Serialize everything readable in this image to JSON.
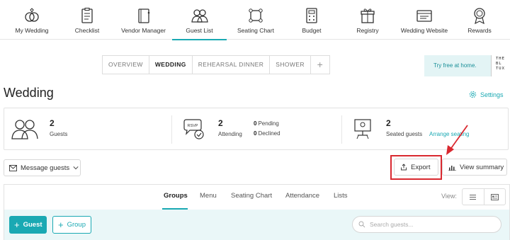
{
  "nav": {
    "items": [
      {
        "label": "My Wedding",
        "icon": "rings-icon"
      },
      {
        "label": "Checklist",
        "icon": "checklist-icon"
      },
      {
        "label": "Vendor Manager",
        "icon": "vendor-book-icon"
      },
      {
        "label": "Guest List",
        "icon": "guests-icon"
      },
      {
        "label": "Seating Chart",
        "icon": "seating-chart-icon"
      },
      {
        "label": "Budget",
        "icon": "calculator-icon"
      },
      {
        "label": "Registry",
        "icon": "gift-icon"
      },
      {
        "label": "Wedding Website",
        "icon": "website-icon"
      },
      {
        "label": "Rewards",
        "icon": "rewards-icon"
      }
    ],
    "active_index": 3
  },
  "event_tabs": [
    "OVERVIEW",
    "WEDDING",
    "REHEARSAL DINNER",
    "SHOWER",
    "+"
  ],
  "active_event_tab": 1,
  "promo": {
    "text": "Try free at home.",
    "logo_lines": [
      "THE",
      "BL",
      "TUX"
    ]
  },
  "page": {
    "title": "Wedding",
    "settings_label": "Settings"
  },
  "stats": {
    "guests": {
      "count": "2",
      "label": "Guests"
    },
    "attending": {
      "count": "2",
      "label": "Attending",
      "pending_count": "0",
      "pending_label": "Pending",
      "declined_count": "0",
      "declined_label": "Declined"
    },
    "seated": {
      "count": "2",
      "label": "Seated guests",
      "link": "Arrange seating"
    }
  },
  "actions": {
    "message": "Message guests",
    "export": "Export",
    "view_summary": "View summary"
  },
  "subtabs": [
    "Groups",
    "Menu",
    "Seating Chart",
    "Attendance",
    "Lists"
  ],
  "active_subtab": 0,
  "view_label": "View:",
  "group_bar": {
    "add_guest": "Guest",
    "add_group": "Group",
    "search_placeholder": "Search guests..."
  },
  "colors": {
    "accent": "#1aa9b3",
    "highlight": "#d9282f"
  }
}
